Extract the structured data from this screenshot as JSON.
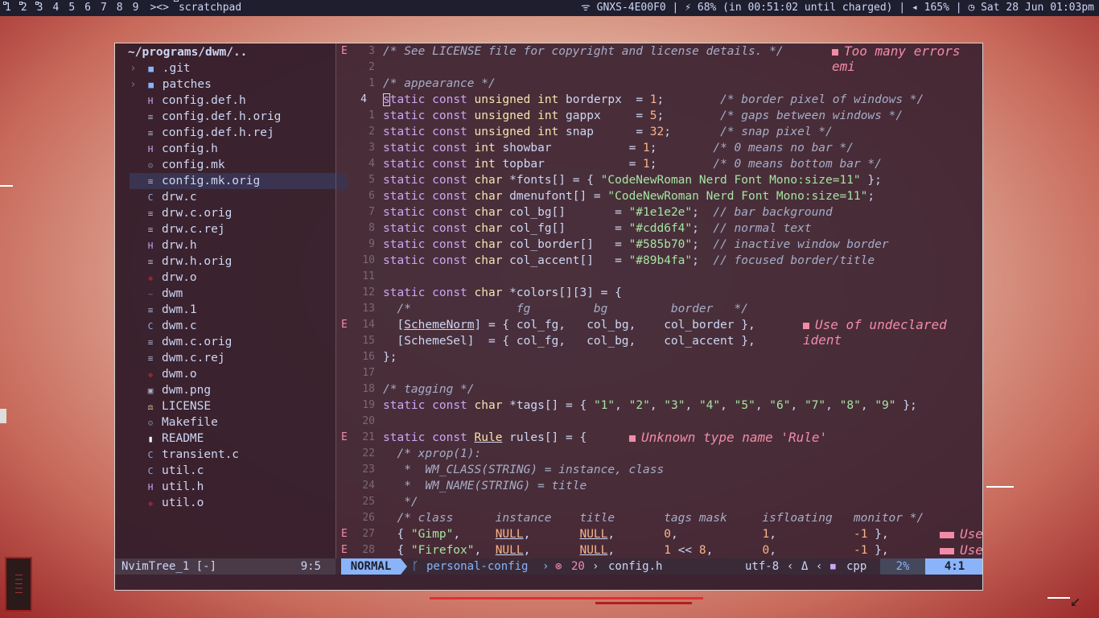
{
  "topbar": {
    "tags": [
      "1",
      "2",
      "3",
      "4",
      "5",
      "6",
      "7",
      "8",
      "9"
    ],
    "layout": "><>",
    "window_title": "scratchpad",
    "wifi": "GNXS-4E00F0",
    "battery": "68% (in 00:51:02 until charged)",
    "volume": "165%",
    "datetime": "Sat 28 Jun 01:03pm"
  },
  "tree": {
    "root": "~/programs/dwm/..",
    "items": [
      {
        "label": ".git",
        "icon": "folder",
        "dir": true
      },
      {
        "label": "patches",
        "icon": "folder",
        "dir": true
      },
      {
        "label": "config.def.h",
        "icon": "h"
      },
      {
        "label": "config.def.h.orig",
        "icon": "file"
      },
      {
        "label": "config.def.h.rej",
        "icon": "file"
      },
      {
        "label": "config.h",
        "icon": "h"
      },
      {
        "label": "config.mk",
        "icon": "mk"
      },
      {
        "label": "config.mk.orig",
        "icon": "file",
        "selected": true
      },
      {
        "label": "drw.c",
        "icon": "c"
      },
      {
        "label": "drw.c.orig",
        "icon": "file"
      },
      {
        "label": "drw.c.rej",
        "icon": "file"
      },
      {
        "label": "drw.h",
        "icon": "h"
      },
      {
        "label": "drw.h.orig",
        "icon": "file"
      },
      {
        "label": "drw.o",
        "icon": "o"
      },
      {
        "label": "dwm",
        "icon": "bin"
      },
      {
        "label": "dwm.1",
        "icon": "file"
      },
      {
        "label": "dwm.c",
        "icon": "c"
      },
      {
        "label": "dwm.c.orig",
        "icon": "file"
      },
      {
        "label": "dwm.c.rej",
        "icon": "file"
      },
      {
        "label": "dwm.o",
        "icon": "o"
      },
      {
        "label": "dwm.png",
        "icon": "img"
      },
      {
        "label": "LICENSE",
        "icon": "license"
      },
      {
        "label": "Makefile",
        "icon": "mk"
      },
      {
        "label": "README",
        "icon": "readme"
      },
      {
        "label": "transient.c",
        "icon": "c"
      },
      {
        "label": "util.c",
        "icon": "c"
      },
      {
        "label": "util.h",
        "icon": "h"
      },
      {
        "label": "util.o",
        "icon": "o"
      }
    ],
    "status_name": "NvimTree_1 [-]",
    "status_pos": "9:5"
  },
  "editor": {
    "line_numbers": [
      "3",
      "2",
      "1",
      "4",
      "1",
      "2",
      "3",
      "4",
      "5",
      "6",
      "7",
      "8",
      "9",
      "10",
      "11",
      "12",
      "13",
      "14",
      "15",
      "16",
      "17",
      "18",
      "19",
      "20",
      "21",
      "22",
      "23",
      "24",
      "25",
      "26",
      "27",
      "28"
    ],
    "diagnostics": [
      "Too many errors emi",
      "Use of undeclared ident",
      "Unknown type name 'Rule'",
      "Use",
      "Use"
    ],
    "status": {
      "mode": "NORMAL",
      "branch": "personal-config",
      "errors": "20",
      "file": "config.h",
      "encoding": "utf-8",
      "filetype": "cpp",
      "percent": "2%",
      "position": "4:1"
    }
  },
  "colors": {
    "bar_bg": "#1e1e2e",
    "fg": "#cdd6f4",
    "accent": "#89b4fa",
    "error": "#f38ba8",
    "keyword": "#cba6f7",
    "type": "#f9e2af",
    "string": "#a6e3a1"
  }
}
